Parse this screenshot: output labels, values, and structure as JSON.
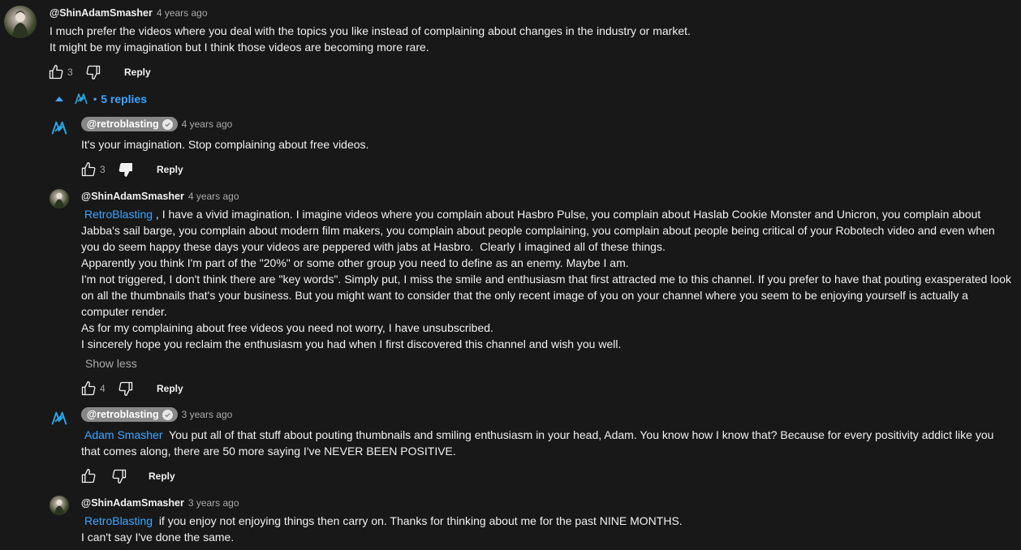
{
  "colors": {
    "background": "#181818",
    "text": "#f1f1f1",
    "secondary_text": "#aaaaaa",
    "link_blue": "#3ea6ff",
    "author_pill": "#888888"
  },
  "top_comment": {
    "author": "@ShinAdamSmasher",
    "time": "4 years ago",
    "lines": [
      "I much prefer the videos where you deal with the topics you like instead of complaining about changes in the industry or market.",
      "It might be my imagination but I think those videos are becoming more rare."
    ],
    "like_count": "3",
    "reply_label": "Reply",
    "avatar_icon": "user-avatar",
    "like_icon": "thumbs-up-icon",
    "dislike_icon": "thumbs-down-icon"
  },
  "replies_toggle": {
    "label": "5 replies",
    "separator": "•",
    "icon": "chevron-up-icon"
  },
  "replies": [
    {
      "author": "@retroblasting",
      "verified": true,
      "time": "4 years ago",
      "mention": "",
      "text": "It's your imagination. Stop complaining about free videos.",
      "like_count": "3",
      "reply_label": "Reply",
      "disliked": true
    },
    {
      "author": "@ShinAdamSmasher",
      "verified": false,
      "time": "4 years ago",
      "mention": "RetroBlasting",
      "text_first": " , I have a vivid imagination. I imagine videos where you complain about Hasbro Pulse, you complain about Haslab Cookie Monster and Unicron, you complain about",
      "text_rest": [
        "Jabba's sail barge, you complain about modern film makers, you complain about people complaining, you complain about people being critical of your Robotech video and even when",
        "you do seem happy these days your videos are peppered with jabs at Hasbro.  Clearly I imagined all of these things.",
        "Apparently you think I'm part of the \"20%\" or some other group you need to define as an enemy. Maybe I am.",
        "I'm not triggered, I don't think there are \"key words\". Simply put, I miss the smile and enthusiasm that first attracted me to this channel. If you prefer to have that pouting exasperated look",
        "on all the thumbnails that's your business. But you might want to consider that the only recent image of you on your channel where you seem to be enjoying yourself is actually a",
        "computer render.",
        "As for my complaining about free videos you need not worry, I have unsubscribed.",
        "I sincerely hope you reclaim the enthusiasm you had when I first discovered this channel and wish you well."
      ],
      "show_less_label": "Show less",
      "like_count": "4",
      "reply_label": "Reply"
    },
    {
      "author": "@retroblasting",
      "verified": true,
      "time": "3 years ago",
      "mention": "Adam Smasher",
      "text_first": "  You put all of that stuff about pouting thumbnails and smiling enthusiasm in your head, Adam. You know how I know that? Because for every positivity addict like you",
      "text_rest": [
        "that comes along, there are 50 more saying I've NEVER BEEN POSITIVE."
      ],
      "like_count": "",
      "reply_label": "Reply"
    },
    {
      "author": "@ShinAdamSmasher",
      "verified": false,
      "time": "3 years ago",
      "mention": "RetroBlasting",
      "text_first": "  if you enjoy not enjoying things then carry on. Thanks for thinking about me for the past NINE MONTHS.",
      "text_rest": [
        "I can't say I've done the same."
      ]
    }
  ]
}
